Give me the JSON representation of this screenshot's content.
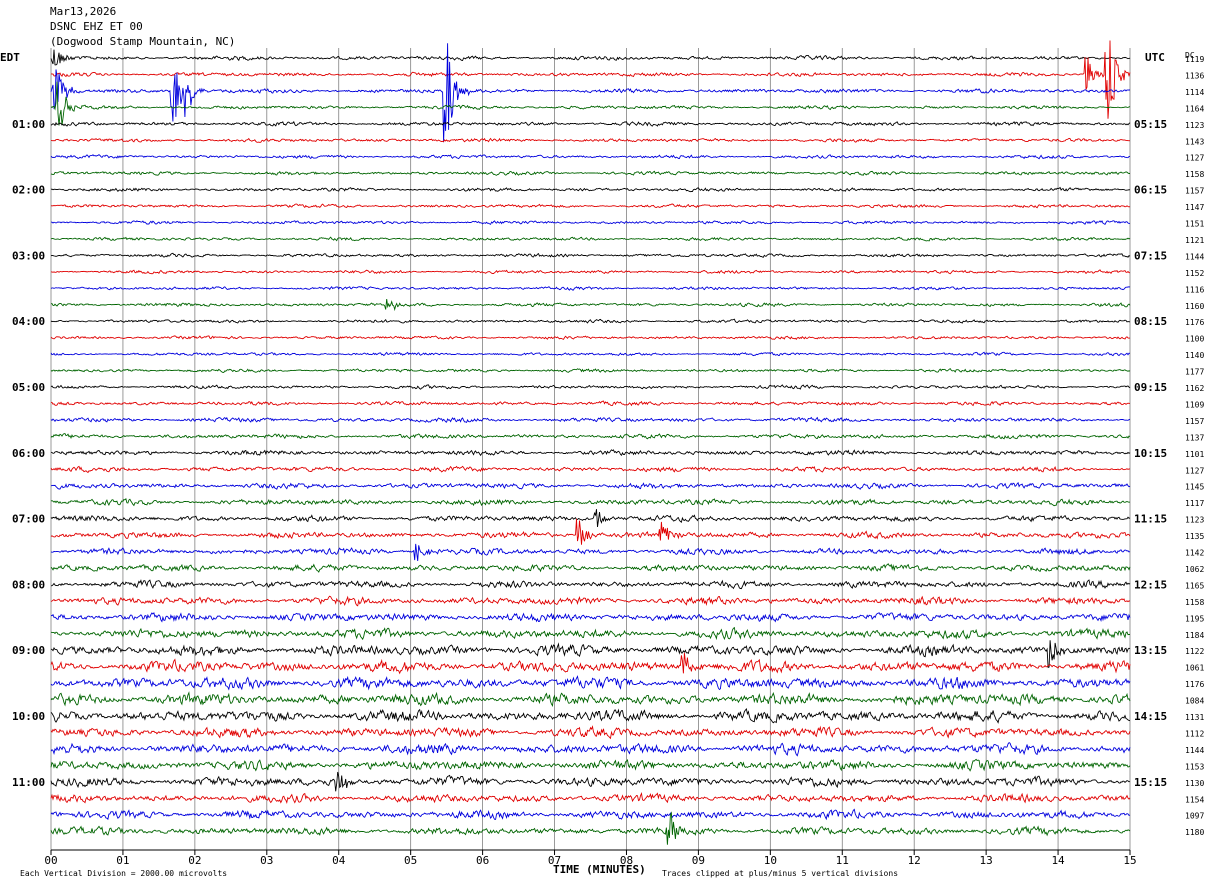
{
  "header": {
    "date": "Mar13,2026",
    "station": "DSNC EHZ ET 00",
    "location": "(Dogwood Stamp Mountain, NC)",
    "left_tz": "EDT",
    "right_tz": "UTC",
    "dc_label": "DC"
  },
  "footer": {
    "scale_note": "Each Vertical Division = 2000.00 microvolts",
    "clip_note": "Traces clipped at plus/minus 5 vertical divisions"
  },
  "colors": {
    "trace_cycle": [
      "#000000",
      "#e00000",
      "#0000dd",
      "#006400"
    ],
    "grid": "#808080",
    "background": "#ffffff"
  },
  "chart_data": {
    "type": "line",
    "title": "DSNC EHZ ET 00 (Dogwood Stamp Mountain, NC)",
    "xlabel": "TIME (MINUTES)",
    "x_ticks": [
      "00",
      "01",
      "02",
      "03",
      "04",
      "05",
      "06",
      "07",
      "08",
      "09",
      "10",
      "11",
      "12",
      "13",
      "14",
      "15"
    ],
    "xlim": [
      0,
      15
    ],
    "minutes_per_line": 15,
    "left_hour_labels": [
      "01:00",
      "02:00",
      "03:00",
      "04:00",
      "05:00",
      "06:00",
      "07:00",
      "08:00",
      "09:00",
      "10:00",
      "11:00"
    ],
    "right_hour_labels": [
      "05:15",
      "06:15",
      "07:15",
      "08:15",
      "09:15",
      "10:15",
      "11:15",
      "12:15",
      "13:15",
      "14:15",
      "15:15"
    ],
    "dc_offsets": [
      1119,
      1136,
      1114,
      1164,
      1123,
      1143,
      1127,
      1158,
      1157,
      1147,
      1151,
      1121,
      1144,
      1152,
      1116,
      1160,
      1176,
      1100,
      1140,
      1177,
      1162,
      1109,
      1157,
      1137,
      1101,
      1127,
      1145,
      1117,
      1123,
      1135,
      1142,
      1062,
      1165,
      1158,
      1195,
      1184,
      1122,
      1061,
      1176,
      1084,
      1131,
      1112,
      1144,
      1153,
      1130,
      1154,
      1097,
      1180
    ],
    "noise_levels": [
      2.1,
      2.0,
      2.2,
      1.8,
      2.0,
      1.8,
      1.8,
      1.8,
      1.8,
      1.7,
      1.7,
      1.6,
      1.7,
      1.7,
      1.6,
      1.8,
      1.7,
      1.6,
      1.6,
      1.7,
      1.8,
      2.0,
      2.3,
      2.3,
      2.6,
      2.6,
      2.8,
      3.0,
      3.1,
      3.2,
      3.2,
      3.4,
      3.6,
      4.0,
      4.2,
      4.8,
      5.4,
      5.8,
      6.0,
      6.0,
      5.8,
      5.0,
      5.4,
      5.0,
      4.8,
      4.2,
      4.2,
      4.0
    ],
    "events": [
      {
        "row": 0,
        "minute": 0.05,
        "amp": 14
      },
      {
        "row": 2,
        "minute": 0.05,
        "amp": 30
      },
      {
        "row": 2,
        "minute": 1.7,
        "amp": 40
      },
      {
        "row": 2,
        "minute": 1.9,
        "amp": 20
      },
      {
        "row": 2,
        "minute": 5.5,
        "amp": 55
      },
      {
        "row": 3,
        "minute": 0.1,
        "amp": 30
      },
      {
        "row": 1,
        "minute": 14.7,
        "amp": 60
      },
      {
        "row": 1,
        "minute": 14.4,
        "amp": 20
      },
      {
        "row": 15,
        "minute": 4.7,
        "amp": 8
      },
      {
        "row": 28,
        "minute": 7.6,
        "amp": 10
      },
      {
        "row": 29,
        "minute": 7.35,
        "amp": 16
      },
      {
        "row": 29,
        "minute": 8.5,
        "amp": 16
      },
      {
        "row": 30,
        "minute": 5.1,
        "amp": 10
      },
      {
        "row": 36,
        "minute": 13.9,
        "amp": 16
      },
      {
        "row": 37,
        "minute": 8.8,
        "amp": 20
      },
      {
        "row": 44,
        "minute": 4.0,
        "amp": 14
      },
      {
        "row": 47,
        "minute": 8.6,
        "amp": 20
      }
    ]
  }
}
